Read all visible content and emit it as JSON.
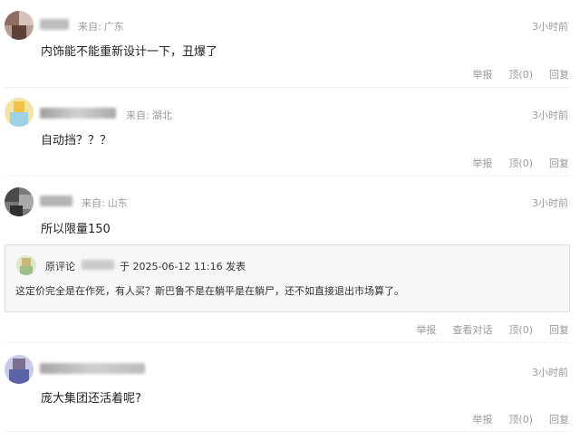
{
  "comments": [
    {
      "username": "",
      "location_prefix": "来自:",
      "location": "广东",
      "time": "3小时前",
      "text": "内饰能不能重新设计一下，丑爆了",
      "actions": {
        "report": "举报",
        "like": "顶(0)",
        "reply": "回复"
      }
    },
    {
      "username": "",
      "location_prefix": "来自:",
      "location": "湖北",
      "time": "3小时前",
      "text": "自动挡？？？",
      "actions": {
        "report": "举报",
        "like": "顶(0)",
        "reply": "回复"
      }
    },
    {
      "username": "",
      "location_prefix": "来自:",
      "location": "山东",
      "time": "3小时前",
      "text": "所以限量150",
      "quote": {
        "label": "原评论",
        "username": "",
        "meta": "于 2025-06-12 11:16  发表",
        "text": "这定价完全是在作死，有人买？斯巴鲁不是在躺平是在躺尸，还不如直接退出市场算了。"
      },
      "actions": {
        "report": "举报",
        "view_dialog": "查看对话",
        "like": "顶(0)",
        "reply": "回复"
      }
    },
    {
      "username": "",
      "time": "3小时前",
      "text": "庞大集团还活着呢?",
      "actions": {
        "report": "举报",
        "like": "顶(0)",
        "reply": "回复"
      }
    }
  ]
}
